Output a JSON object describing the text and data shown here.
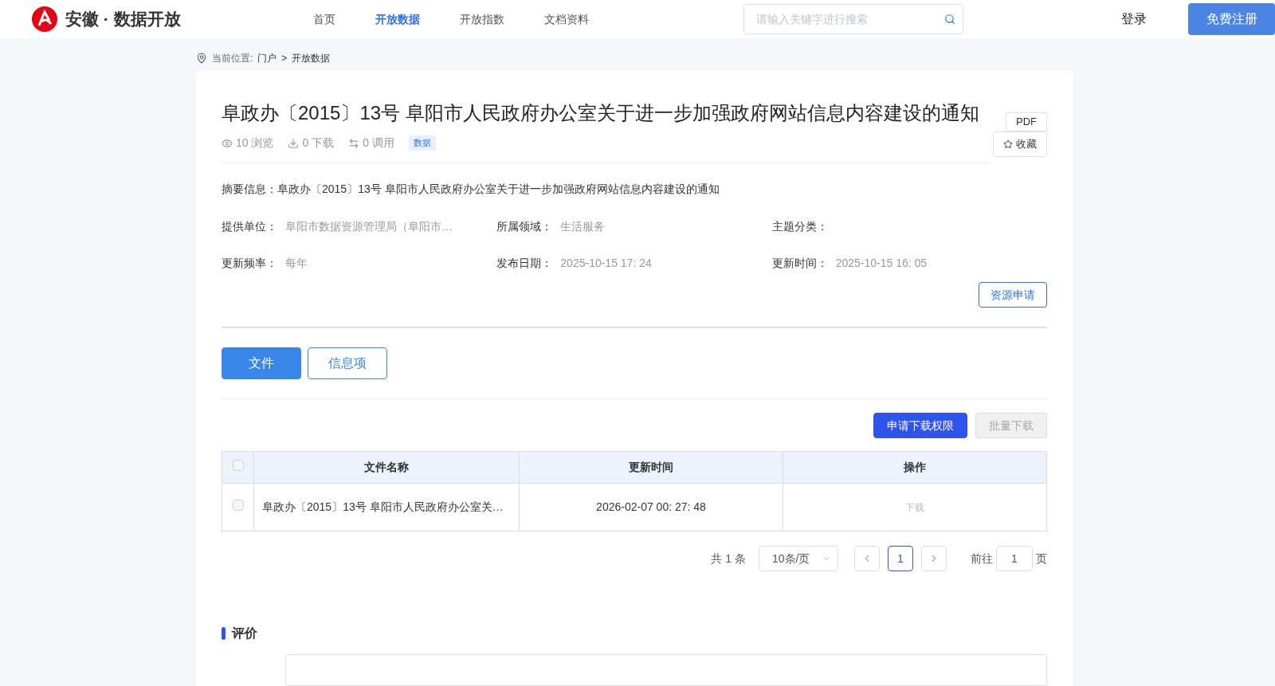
{
  "header": {
    "logo_text": "安徽 · 数据开放",
    "nav": [
      {
        "label": "首页",
        "selected": false
      },
      {
        "label": "开放数据",
        "selected": true
      },
      {
        "label": "开放指数",
        "selected": false
      },
      {
        "label": "文档资料",
        "selected": false
      }
    ],
    "search": {
      "placeholder": "请输入关键字进行搜索"
    },
    "login": "登录",
    "register": "免费注册"
  },
  "breadcrumb": {
    "label": "当前位置:",
    "items": [
      "门户",
      ">",
      "开放数据"
    ]
  },
  "dataset": {
    "title": "阜政办〔2015〕13号 阜阳市人民政府办公室关于进一步加强政府网站信息内容建设的通知",
    "format": "PDF",
    "favorite": "收藏",
    "stats": [
      {
        "kind": "views",
        "text": "10 浏览"
      },
      {
        "kind": "downloads",
        "text": "0 下载"
      },
      {
        "kind": "calls",
        "text": "0 调用"
      }
    ],
    "tag": "数据",
    "summary": "摘要信息：阜政办〔2015〕13号 阜阳市人民政府办公室关于进一步加强政府网站信息内容建设的通知",
    "fields": [
      {
        "label": "提供单位：",
        "value": "阜阳市数据资源管理局（阜阳市…"
      },
      {
        "label": "所属领域：",
        "value": "生活服务"
      },
      {
        "label": "主题分类："
      },
      {
        "label": "更新频率：",
        "value": "每年"
      },
      {
        "label": "发布日期：",
        "value": "2025-10-15 17: 24"
      },
      {
        "label": "更新时间：",
        "value": "2025-10-15 16: 05"
      }
    ],
    "apply_button": "资源申请"
  },
  "tabs": [
    {
      "label": "文件",
      "selected": true
    },
    {
      "label": "信息项",
      "selected": false
    }
  ],
  "toolbar": [
    {
      "label": "申请下载权限",
      "disabled": false
    },
    {
      "label": "批量下载",
      "disabled": true
    }
  ],
  "table": {
    "select_all": {
      "checked": false
    },
    "columns": [
      "文件名称",
      "更新时间",
      "操作"
    ],
    "rows": [
      {
        "checked": false,
        "name": "阜政办〔2015〕13号 阜阳市人民政府办公室关…",
        "time": "2026-02-07 00: 27: 48",
        "action": {
          "label": "下载",
          "disabled": true
        }
      }
    ]
  },
  "pagination": {
    "total": "共 1 条",
    "page_size": "10条/页",
    "pages": [
      {
        "label": "1",
        "selected": true
      }
    ],
    "goto_label": "前往",
    "goto_value": "1",
    "goto_suffix": "页"
  },
  "review": {
    "title": "评价"
  }
}
